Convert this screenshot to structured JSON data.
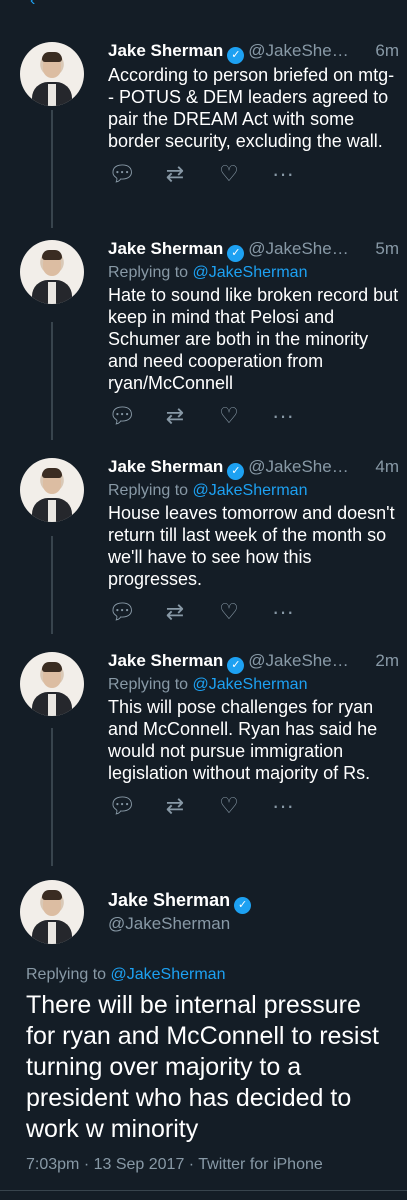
{
  "author": {
    "name": "Jake Sherman",
    "handle_truncated": "@JakeShe…",
    "handle_full": "@JakeSherman",
    "verified_symbol": "✓"
  },
  "reply_prefix": "Replying to",
  "reply_mention": "@JakeSherman",
  "tweets": [
    {
      "time": "6m",
      "text": "According to person briefed on mtg-- POTUS & DEM leaders agreed to pair the DREAM Act with some border security, excluding the wall."
    },
    {
      "time": "5m",
      "text": "Hate to sound like broken record but keep in mind that Pelosi and Schumer are both in the minority and need cooperation from ryan/McConnell"
    },
    {
      "time": "4m",
      "text": "House leaves tomorrow and doesn't return till last week of the month so we'll have to see how this progresses."
    },
    {
      "time": "2m",
      "text": "This will pose challenges for ryan and McConnell. Ryan has said he would not pursue immigration legislation without majority of Rs."
    }
  ],
  "main_tweet": {
    "text": "There will be internal pressure for ryan and McConnell to resist turning over majority to a president who has decided to work w minority",
    "meta": "7:03pm · 13 Sep 2017 · Twitter for iPhone"
  },
  "icons": {
    "reply": "reply-icon",
    "retweet": "retweet-icon",
    "like": "heart-icon",
    "more": "more-icon",
    "back": "chevron-left-icon"
  },
  "colors": {
    "background": "#141d26",
    "accent": "#1da1f2",
    "secondary_text": "#8899a6",
    "divider": "#38444d"
  }
}
